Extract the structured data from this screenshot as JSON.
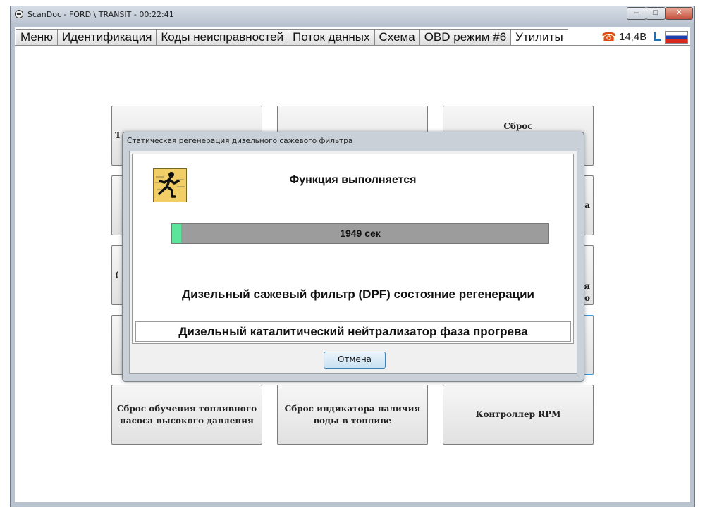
{
  "window": {
    "title": "ScanDoc - FORD \\ TRANSIT - 00:22:41",
    "minimize": "–",
    "maximize": "□",
    "close": "✕"
  },
  "tabs": [
    "Меню",
    "Идентификация",
    "Коды неисправностей",
    "Поток данных",
    "Схема",
    "OBD режим #6",
    "Утилиты"
  ],
  "active_tab": "Утилиты",
  "status": {
    "voltage": "14,4В",
    "phone_icon": "phone-icon",
    "plug_icon": "plug-icon",
    "flag_icon": "russian-flag-icon"
  },
  "utilities": {
    "row1": [
      "Т",
      "",
      "Сброс запрограммированных"
    ],
    "row2_right_fragment": "а",
    "row3_left_fragment": "(",
    "row3_right_fragment": [
      "я",
      "о"
    ],
    "row5": [
      "Сброс обучения топливного насоса высокого давления",
      "Сброс индикатора наличия воды в топливе",
      "Контроллер RPM"
    ]
  },
  "dialog": {
    "title": "Статическая регенерация дизельного сажевого фильтра",
    "function_text": "Функция выполняется",
    "progress": {
      "label": "1949 сек",
      "fill_fraction": 0.025,
      "color": "#5be59a"
    },
    "status_text": "Дизельный сажевый фильтр (DPF) состояние регенерации",
    "phase_text": "Дизельный каталитический нейтрализатор фаза прогрева",
    "cancel": "Отмена",
    "icon": "running-man-icon"
  }
}
